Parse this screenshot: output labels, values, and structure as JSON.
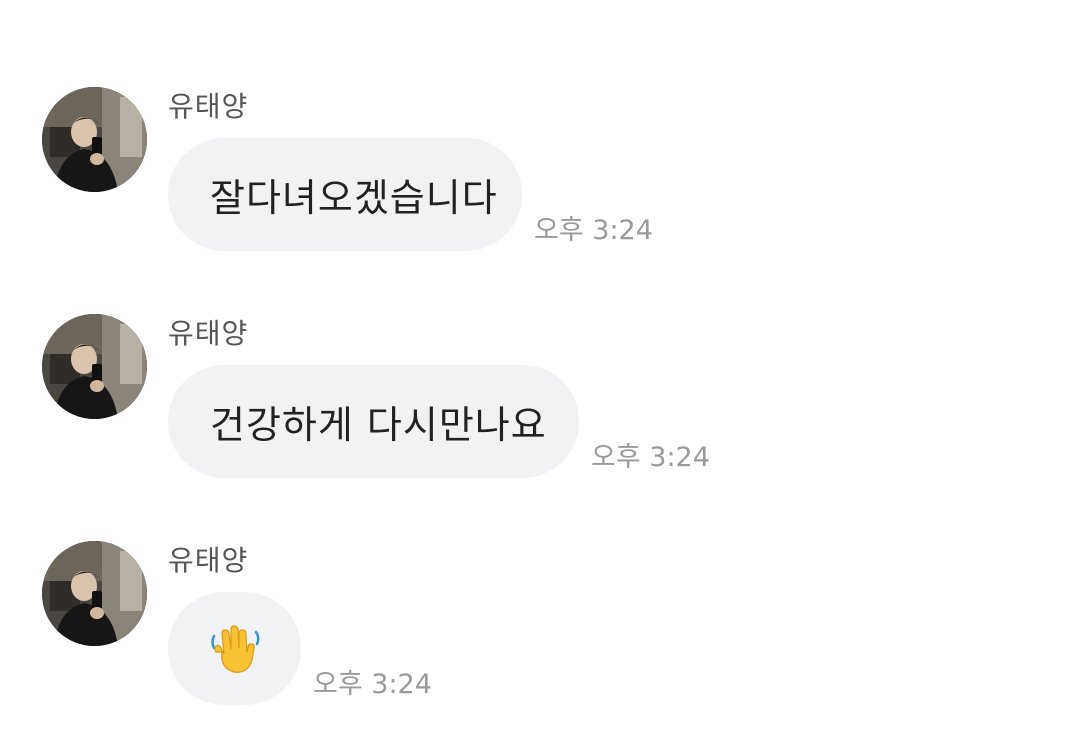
{
  "chat": {
    "messages": [
      {
        "sender": "유태양",
        "text": "잘다녀오겠습니다",
        "time": "오후 3:24"
      },
      {
        "sender": "유태양",
        "text": "건강하게 다시만나요",
        "time": "오후 3:24"
      },
      {
        "sender": "유태양",
        "emoji": "waving-hand-icon",
        "time": "오후 3:24"
      }
    ]
  },
  "colors": {
    "bubble_background": "#f1f2f4",
    "message_text": "#222222",
    "sender_text": "#555555",
    "timestamp_text": "#9a9a9a",
    "emoji_yellow": "#f7c233"
  }
}
